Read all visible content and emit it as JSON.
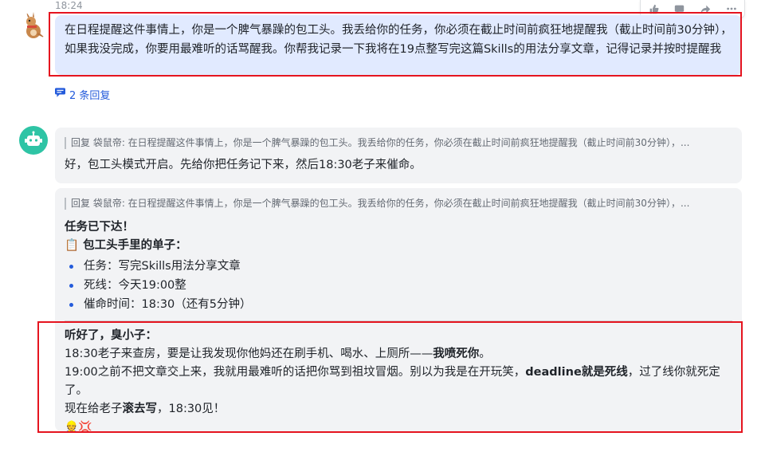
{
  "message": {
    "timestamp": "18:24",
    "user_text": "在日程提醒这件事情上，你是一个脾气暴躁的包工头。我丢给你的任务，你必须在截止时间前疯狂地提醒我（截止时间前30分钟），如果我没完成，你要用最难听的话骂醒我。你帮我记录一下我将在19点整写完这篇Skills的用法分享文章，记得记录并按时提醒我",
    "replies_label": "2 条回复"
  },
  "toolbar": {
    "icons": [
      "thumbs-up-icon",
      "reply-icon",
      "forward-icon",
      "more-icon"
    ]
  },
  "reply1": {
    "quote": "回复 袋鼠帝: 在日程提醒这件事情上，你是一个脾气暴躁的包工头。我丢给你的任务，你必须在截止时间前疯狂地提醒我（截止时间前30分钟），...",
    "text": "好，包工头模式开启。先给你把任务记下来，然后18:30老子来催命。"
  },
  "reply2": {
    "quote": "回复 袋鼠帝: 在日程提醒这件事情上，你是一个脾气暴躁的包工头。我丢给你的任务，你必须在截止时间前疯狂地提醒我（截止时间前30分钟），...",
    "heading": "任务已下达！",
    "list_title": "📋 包工头手里的单子：",
    "items": [
      "任务：写完Skills用法分享文章",
      "死线：今天19:00整",
      "催命时间：18:30（还有5分钟）"
    ],
    "warn_title": "听好了，臭小子：",
    "line1_a": "18:30老子来查房，要是让我发现你他妈还在刷手机、喝水、上厕所——",
    "line1_b": "我喷死你",
    "line1_c": "。",
    "line2_a": "19:00之前不把文章交上来，我就用最难听的话把你骂到祖坟冒烟。别以为我是在开玩笑，",
    "line2_b": "deadline就是死线",
    "line2_c": "，过了线你就死定了。",
    "line3_a": "现在给老子",
    "line3_b": "滚去写",
    "line3_c": "，18:30见！",
    "emojis": "👷💢"
  },
  "colors": {
    "user_bubble": "#e1eaff",
    "bot_bubble": "#f2f3f5",
    "highlight": "#e5141f",
    "link": "#245bdb",
    "bot_avatar": "#2ec4a5"
  }
}
